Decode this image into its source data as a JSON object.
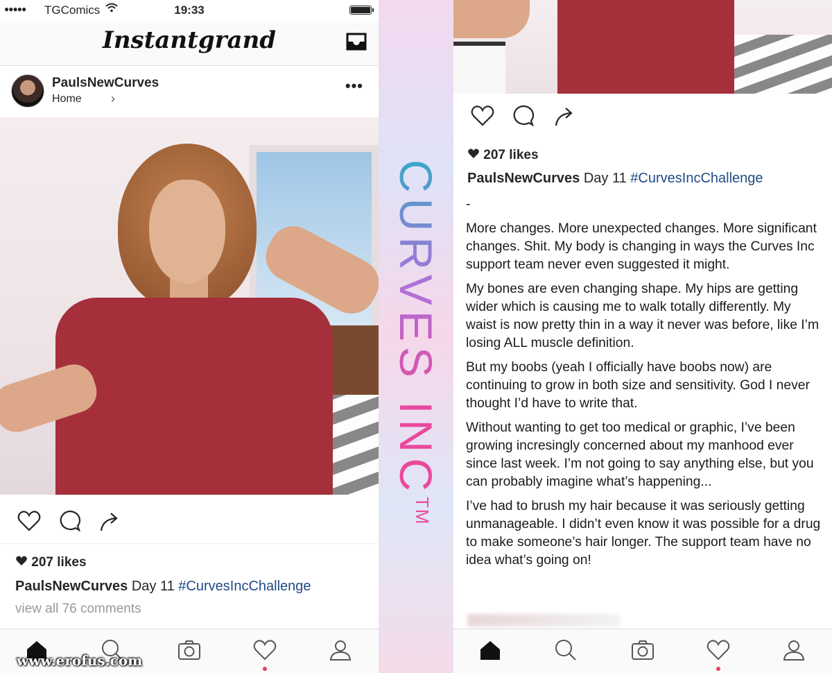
{
  "status_bar": {
    "carrier": "TGComics",
    "time": "19:33"
  },
  "app": {
    "logo": "Instantgrand"
  },
  "post": {
    "username": "PaulsNewCurves",
    "location": "Home",
    "likes": "207 likes",
    "caption_user": "PaulsNewCurves",
    "caption_text": " Day 11 ",
    "hashtag": "#CurvesIncChallenge",
    "comments_link": "view all 76 comments"
  },
  "band": {
    "brand": "CURVES INC",
    "tm": "TM"
  },
  "right": {
    "likes": "207 likes",
    "caption_user": "PaulsNewCurves",
    "caption_text": " Day 11 ",
    "hashtag": "#CurvesIncChallenge",
    "dash": "-",
    "paragraphs": [
      "More changes. More unexpected changes. More significant changes. Shit. My body is changing in ways the Curves Inc support team never even suggested it might.",
      "My bones are even changing shape. My hips are getting wider which is causing me to walk totally differently. My waist is now pretty thin in a way it never was before, like I’m losing ALL muscle definition.",
      "But my boobs (yeah I officially have boobs now) are continuing to grow in both size and sensitivity. God I never thought I’d have to write that.",
      "Without wanting to get too medical or graphic, I’ve been growing incresingly concerned about my manhood ever since last week. I’m not going to say anything else, but you can probably imagine what’s happening...",
      "I’ve had to brush my hair because it was seriously getting unmanageable. I didn’t even know it was possible for a drug to make someone’s hair longer. The support team have no idea what’s going on!"
    ]
  },
  "watermark": "www.erofus.com",
  "icons": [
    "heart-icon",
    "comment-icon",
    "share-icon",
    "home-icon",
    "search-icon",
    "camera-icon",
    "activity-heart-icon",
    "profile-icon",
    "inbox-icon",
    "more-icon"
  ],
  "colors": {
    "hashtag": "#1f4b86",
    "notification_dot": "#e4405f",
    "brand_gradient": [
      "#3aa7c9",
      "#b070d8",
      "#e9489c"
    ]
  }
}
